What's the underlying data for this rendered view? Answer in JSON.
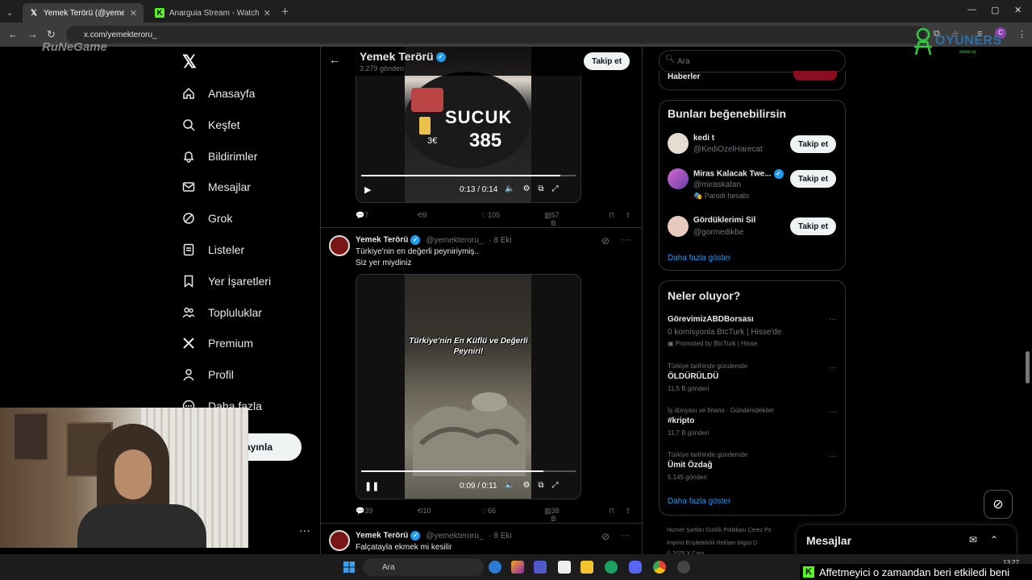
{
  "browser": {
    "tabs": [
      {
        "label": "Yemek Terörü (@yemekter...",
        "active": true,
        "favicon": "x-icon"
      },
      {
        "label": "Anarguia Stream - Watch Live o...",
        "active": false,
        "favicon": "kick-icon"
      }
    ],
    "url": "x.com/yemekteroru_",
    "profile_initial": "C"
  },
  "overlays": {
    "left_logo": "RuNeGame",
    "right_logo": "OYUNERS",
    "right_logo_sub": "www.oy"
  },
  "nav": {
    "items": [
      {
        "label": "Anasayfa",
        "icon": "home-icon"
      },
      {
        "label": "Keşfet",
        "icon": "search-icon"
      },
      {
        "label": "Bildirimler",
        "icon": "bell-icon"
      },
      {
        "label": "Mesajlar",
        "icon": "mail-icon"
      },
      {
        "label": "Grok",
        "icon": "grok-icon"
      },
      {
        "label": "Listeler",
        "icon": "list-icon"
      },
      {
        "label": "Yer İşaretleri",
        "icon": "bookmark-icon"
      },
      {
        "label": "Topluluklar",
        "icon": "communities-icon"
      },
      {
        "label": "Premium",
        "icon": "x-icon"
      },
      {
        "label": "Profil",
        "icon": "profile-icon"
      },
      {
        "label": "Daha fazla",
        "icon": "more-circle-icon"
      }
    ],
    "post_button": "ayınla"
  },
  "timeline": {
    "name": "Yemek Terörü",
    "posts_count": "3.279 gönderi",
    "follow_label": "Takip et",
    "tweet1": {
      "video_text": "SUCUK",
      "video_price": "385",
      "video_tag": "3€",
      "time": "0:13 / 0:14",
      "progress": 0.93,
      "replies": "7",
      "reposts": "9",
      "likes": "105",
      "views": "57 B"
    },
    "tweet2": {
      "name": "Yemek Terörü",
      "handle": "@yemekteroru_",
      "date": "· 8 Eki",
      "text_line1": "Türkiye'nin en değerli peyniriymiş..",
      "text_line2": "Siz yer miydiniz",
      "video_caption": "Türkiye'nin En Küflü ve Değerli Peyniri!",
      "time": "0:09 / 0:11",
      "progress": 0.85,
      "replies": "39",
      "reposts": "10",
      "likes": "66",
      "views": "38 B"
    },
    "tweet3": {
      "name": "Yemek Terörü",
      "handle": "@yemekteroru_",
      "date": "· 8 Eki",
      "text": "Falçatayla ekmek mi kesilir"
    }
  },
  "right": {
    "search_placeholder": "Ara",
    "news_partial": "Haberler",
    "suggest_title": "Bunları beğenebilirsin",
    "suggestions": [
      {
        "name": "kedi t",
        "handle": "@KediOzelHarecat",
        "extra": ""
      },
      {
        "name": "Miras Kalacak Twe...",
        "handle": "@miraskaIan",
        "extra": "Parodi hesabı"
      },
      {
        "name": "Gördüklerimi Sil",
        "handle": "@gormedikbe",
        "extra": ""
      }
    ],
    "follow_label": "Takip et",
    "show_more": "Daha fazla göster",
    "trends_title": "Neler oluyor?",
    "trends": [
      {
        "meta": "",
        "title": "GörevimizABDBorsası",
        "sub": "0 komisyonla BtcTurk | Hisse'de",
        "sub2": "Promoted by BtcTurk | Hisse"
      },
      {
        "meta": "Türkiye tarihinde gündemde",
        "title": "ÖLDÜRÜLDÜ",
        "sub": "11,5 B gönderi",
        "sub2": ""
      },
      {
        "meta": "İş dünyası ve finans · Gündemdekiler",
        "title": "#kripto",
        "sub": "11,7 B gönderi",
        "sub2": ""
      },
      {
        "meta": "Türkiye tarihinde gündemde",
        "title": "Ümit Özdağ",
        "sub": "5.145 gönderi",
        "sub2": ""
      }
    ],
    "footer_row1": "Hizmet Şartları   Gizlilik Politikası   Çerez Po",
    "footer_row2": "Imprint   Erişilebilirlik   Reklam bilgisi   D",
    "footer_row3": "© 2025 X Corp."
  },
  "messages_bar": {
    "label": "Mesajlar"
  },
  "taskbar": {
    "search": "Ara",
    "time": "13:27",
    "ticker": "Affetmeyici o zamandan beri etkiledi beni"
  }
}
